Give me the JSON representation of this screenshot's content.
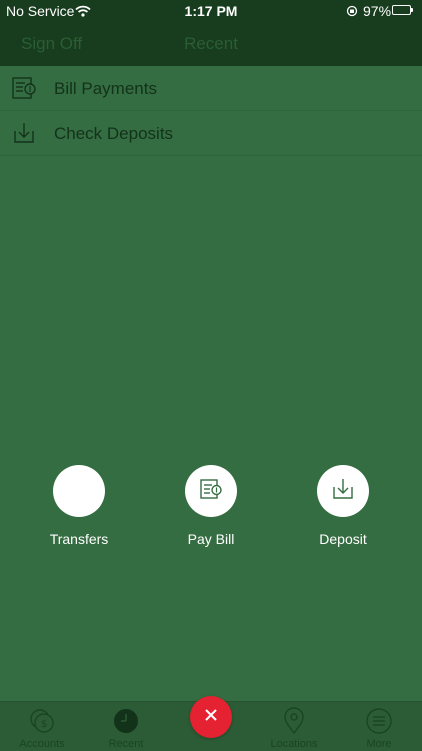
{
  "status_bar": {
    "carrier": "No Service",
    "time": "1:17 PM",
    "battery": "97%",
    "battery_level": 0.97
  },
  "nav": {
    "left_button": "Sign Off",
    "title": "Recent"
  },
  "list": [
    {
      "label": "Bill Payments",
      "icon": "bill-payment-icon"
    },
    {
      "label": "Check Deposits",
      "icon": "check-deposit-icon"
    }
  ],
  "actions": [
    {
      "label": "Transfers",
      "icon": "transfers-icon"
    },
    {
      "label": "Pay Bill",
      "icon": "pay-bill-icon"
    },
    {
      "label": "Deposit",
      "icon": "deposit-icon"
    }
  ],
  "tabs": [
    {
      "label": "Accounts",
      "icon": "accounts-icon"
    },
    {
      "label": "Recent",
      "icon": "recent-clock-icon"
    },
    {
      "label": "Locations",
      "icon": "location-pin-icon"
    },
    {
      "label": "More",
      "icon": "menu-icon"
    }
  ],
  "colors": {
    "overlay_green": "#356d42",
    "header_dark_green": "#183c1e",
    "close_button_red": "#e52232",
    "white": "#ffffff"
  }
}
